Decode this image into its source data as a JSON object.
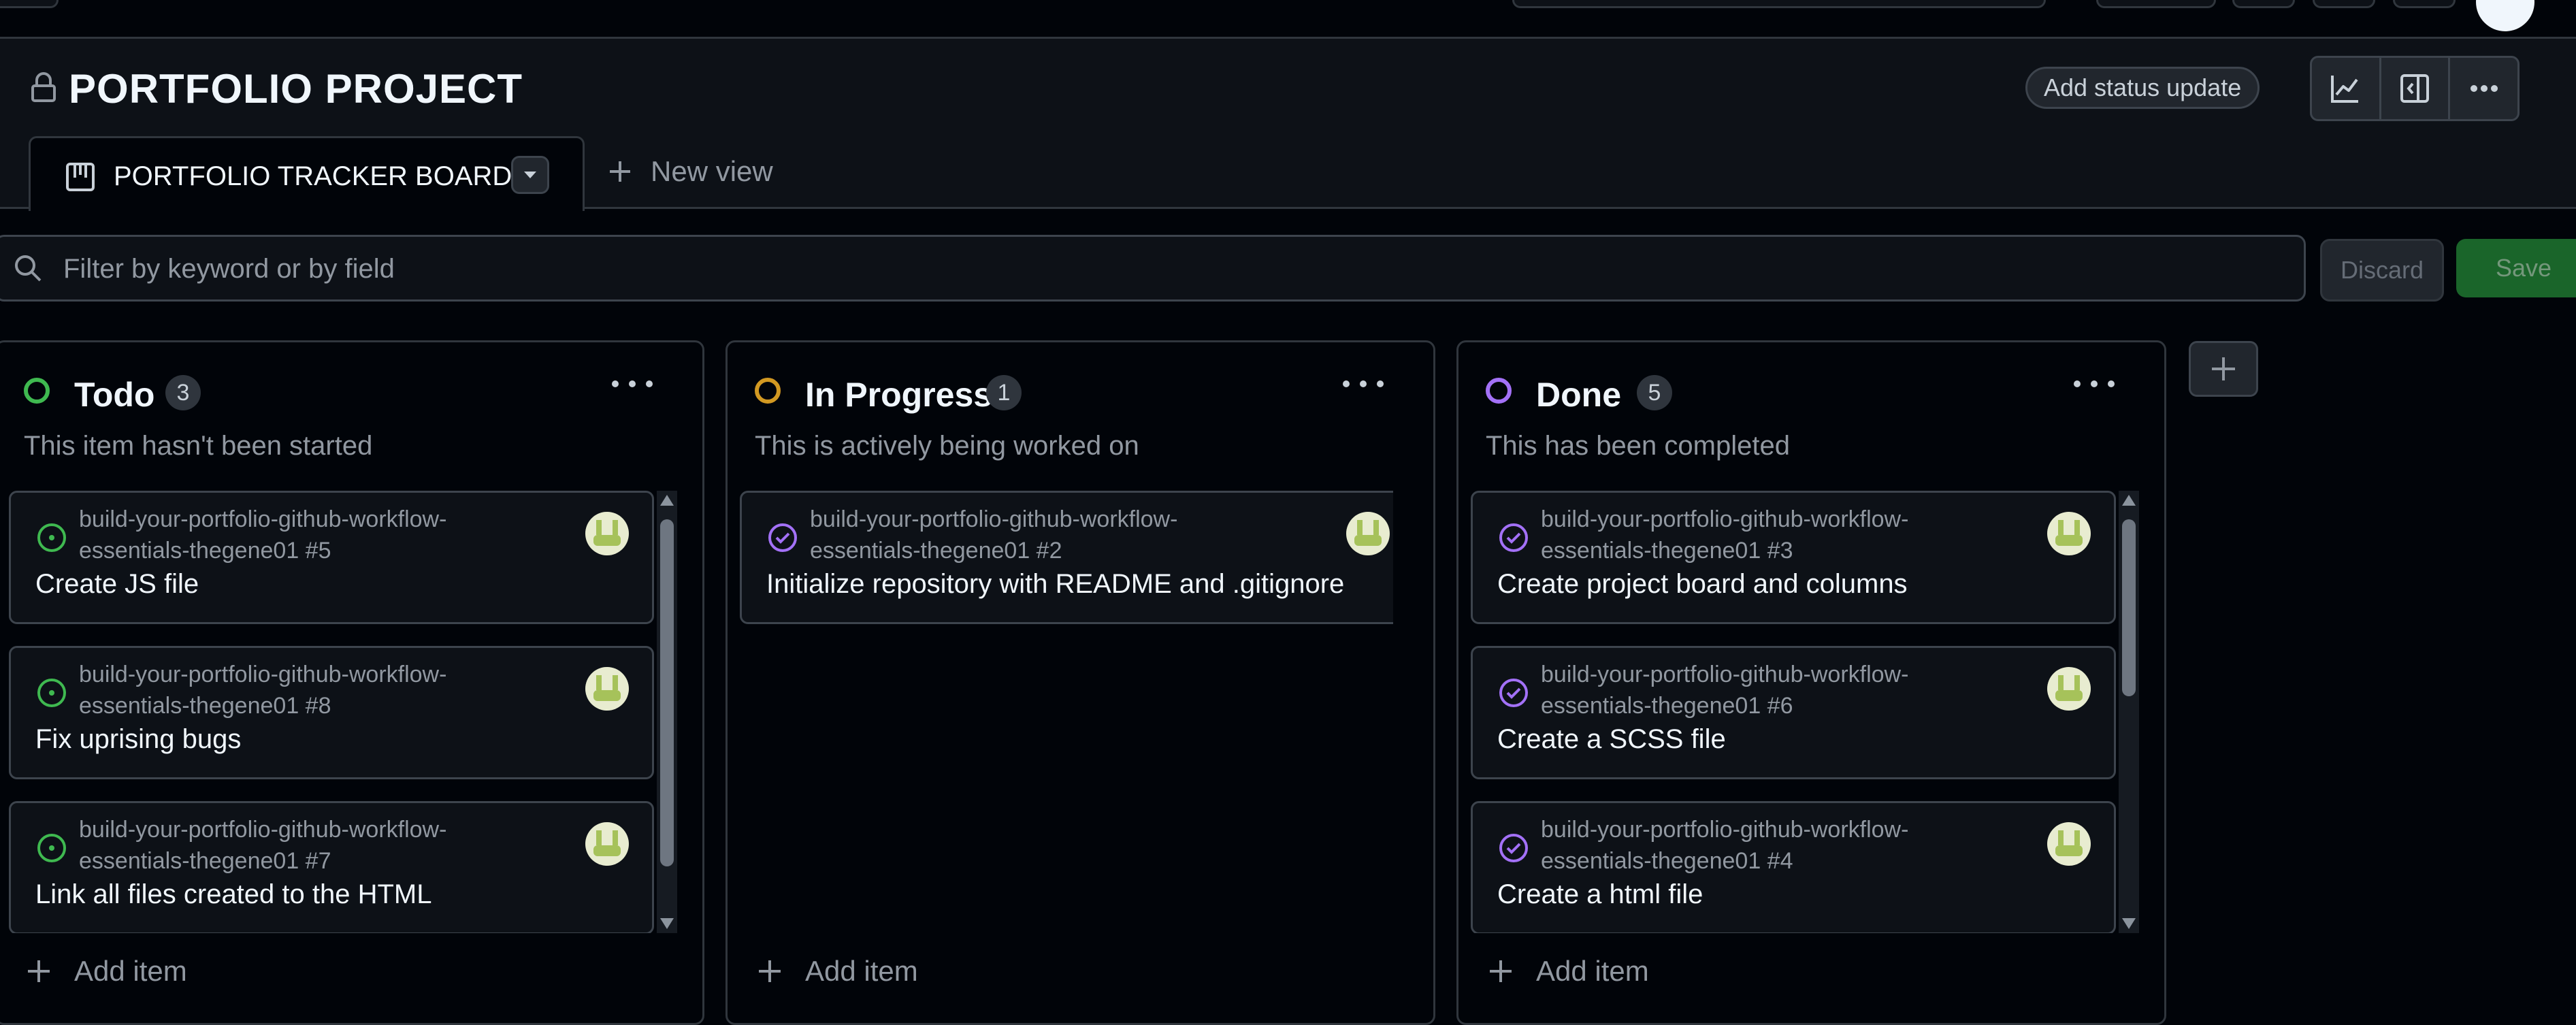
{
  "project": {
    "title": "PORTFOLIO PROJECT",
    "status_button": "Add status update"
  },
  "view": {
    "active_tab": "PORTFOLIO TRACKER BOARD",
    "new_view": "New view"
  },
  "filter": {
    "placeholder": "Filter by keyword or by field",
    "discard": "Discard",
    "save": "Save"
  },
  "colors": {
    "todo": "#3fb950",
    "in_progress": "#d29922",
    "done": "#a371f7",
    "accent_save": "#238636"
  },
  "columns": [
    {
      "name": "Todo",
      "count": "3",
      "description": "This item hasn't been started",
      "status_icon": "open-circle-icon",
      "add_item": "Add item",
      "cards": [
        {
          "ref": "build-your-portfolio-github-workflow-essentials-thegene01 #5",
          "title": "Create JS file",
          "icon": "issue-open-icon"
        },
        {
          "ref": "build-your-portfolio-github-workflow-essentials-thegene01 #8",
          "title": "Fix uprising bugs",
          "icon": "issue-open-icon"
        },
        {
          "ref": "build-your-portfolio-github-workflow-essentials-thegene01 #7",
          "title": "Link all files created to the HTML",
          "icon": "issue-open-icon"
        }
      ]
    },
    {
      "name": "In Progress",
      "count": "1",
      "description": "This is actively being worked on",
      "status_icon": "in-progress-circle-icon",
      "add_item": "Add item",
      "cards": [
        {
          "ref": "build-your-portfolio-github-workflow-essentials-thegene01 #2",
          "title": "Initialize repository with README and .gitignore",
          "icon": "issue-closed-icon"
        }
      ]
    },
    {
      "name": "Done",
      "count": "5",
      "description": "This has been completed",
      "status_icon": "done-circle-icon",
      "add_item": "Add item",
      "cards": [
        {
          "ref": "build-your-portfolio-github-workflow-essentials-thegene01 #3",
          "title": "Create project board and columns",
          "icon": "issue-closed-icon"
        },
        {
          "ref": "build-your-portfolio-github-workflow-essentials-thegene01 #6",
          "title": "Create a SCSS file",
          "icon": "issue-closed-icon"
        },
        {
          "ref": "build-your-portfolio-github-workflow-essentials-thegene01 #4",
          "title": "Create a html file",
          "icon": "issue-closed-icon"
        }
      ]
    }
  ]
}
